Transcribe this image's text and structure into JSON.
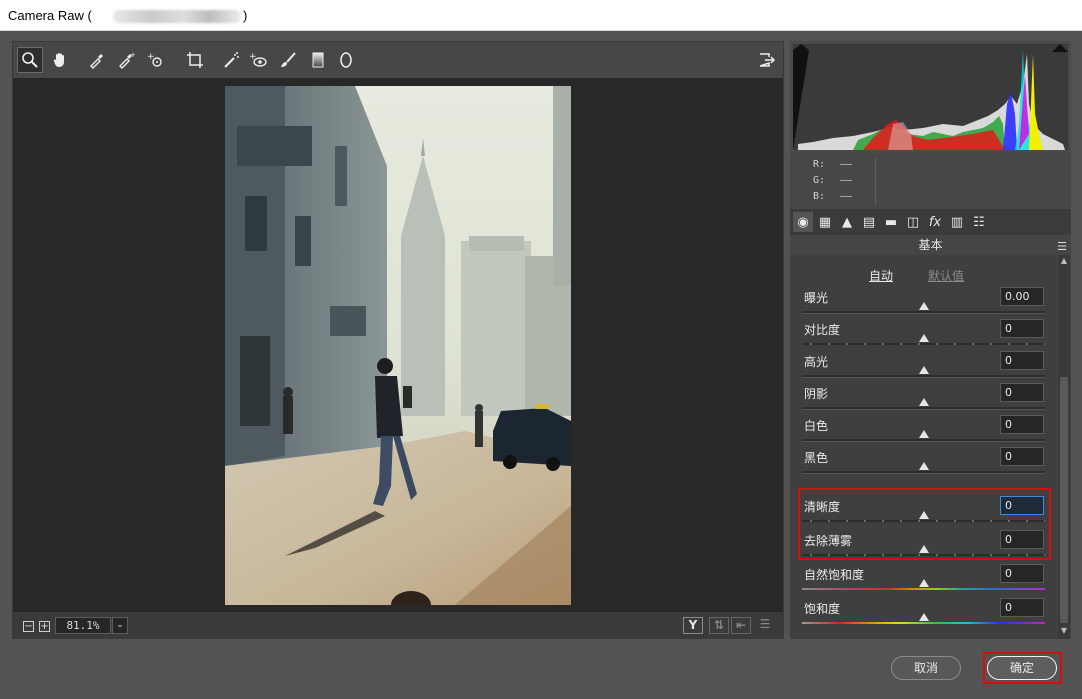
{
  "window": {
    "title": "Camera Raw (",
    "title_close": ")"
  },
  "toolbar": {
    "tools": [
      "zoom-icon",
      "hand-icon",
      "white-balance-icon",
      "color-sampler-icon",
      "targeted-adjust-icon",
      "crop-icon",
      "spot-removal-icon",
      "red-eye-icon",
      "adjustment-brush-icon",
      "graduated-filter-icon",
      "radial-filter-icon"
    ],
    "open_prefs": "preferences-icon"
  },
  "status": {
    "zoom_out": "−",
    "zoom_in": "+",
    "zoom_value": "81.1%",
    "zoom_dropdown": "⌄",
    "compare_label": "Y"
  },
  "rgb": {
    "r_label": "R:",
    "g_label": "G:",
    "b_label": "B:",
    "r_value": "——",
    "g_value": "——",
    "b_value": "——"
  },
  "panel": {
    "section_title": "基本",
    "auto_label": "自动",
    "default_label": "默认值",
    "sliders": [
      {
        "label": "曝光",
        "value": "0.00",
        "position": 0.5
      },
      {
        "label": "对比度",
        "value": "0",
        "position": 0.5
      },
      {
        "label": "高光",
        "value": "0",
        "position": 0.5
      },
      {
        "label": "阴影",
        "value": "0",
        "position": 0.5
      },
      {
        "label": "白色",
        "value": "0",
        "position": 0.5
      },
      {
        "label": "黑色",
        "value": "0",
        "position": 0.5
      },
      {
        "label": "清晰度",
        "value": "0",
        "position": 0.5
      },
      {
        "label": "去除薄雾",
        "value": "0",
        "position": 0.5
      },
      {
        "label": "自然饱和度",
        "value": "0",
        "position": 0.5
      },
      {
        "label": "饱和度",
        "value": "0",
        "position": 0.5
      }
    ]
  },
  "buttons": {
    "cancel": "取消",
    "ok": "确定"
  },
  "colors": {
    "highlight_box": "#d40e0e",
    "focus_field": "#3b8be0"
  }
}
